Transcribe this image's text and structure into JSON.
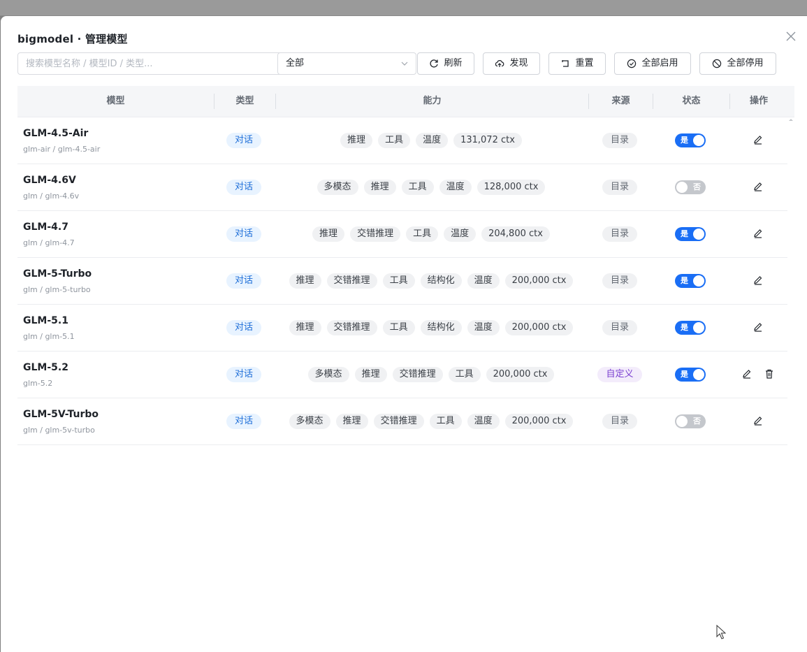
{
  "dialog": {
    "title": "bigmodel · 管理模型"
  },
  "toolbar": {
    "search_placeholder": "搜索模型名称 / 模型ID / 类型...",
    "filter_value": "全部",
    "refresh": "刷新",
    "discover": "发现",
    "reset": "重置",
    "enable_all": "全部启用",
    "disable_all": "全部停用"
  },
  "columns": {
    "model": "模型",
    "type": "类型",
    "capabilities": "能力",
    "source": "来源",
    "status": "状态",
    "actions": "操作"
  },
  "rows": [
    {
      "name": "GLM-4.5-Air",
      "id": "glm-air / glm-4.5-air",
      "type": "对话",
      "caps": [
        "推理",
        "工具",
        "温度",
        "131,072 ctx"
      ],
      "source": "目录",
      "enabled": true,
      "status": "是"
    },
    {
      "name": "GLM-4.6V",
      "id": "glm / glm-4.6v",
      "type": "对话",
      "caps": [
        "多模态",
        "推理",
        "工具",
        "温度",
        "128,000 ctx"
      ],
      "source": "目录",
      "enabled": false,
      "status": "否"
    },
    {
      "name": "GLM-4.7",
      "id": "glm / glm-4.7",
      "type": "对话",
      "caps": [
        "推理",
        "交错推理",
        "工具",
        "温度",
        "204,800 ctx"
      ],
      "source": "目录",
      "enabled": true,
      "status": "是"
    },
    {
      "name": "GLM-5-Turbo",
      "id": "glm / glm-5-turbo",
      "type": "对话",
      "caps": [
        "推理",
        "交错推理",
        "工具",
        "结构化",
        "温度",
        "200,000 ctx"
      ],
      "source": "目录",
      "enabled": true,
      "status": "是"
    },
    {
      "name": "GLM-5.1",
      "id": "glm / glm-5.1",
      "type": "对话",
      "caps": [
        "推理",
        "交错推理",
        "工具",
        "结构化",
        "温度",
        "200,000 ctx"
      ],
      "source": "目录",
      "enabled": true,
      "status": "是"
    },
    {
      "name": "GLM-5.2",
      "id": "glm-5.2",
      "type": "对话",
      "caps": [
        "多模态",
        "推理",
        "交错推理",
        "工具",
        "200,000 ctx"
      ],
      "source": "自定义",
      "enabled": true,
      "status": "是"
    },
    {
      "name": "GLM-5V-Turbo",
      "id": "glm / glm-5v-turbo",
      "type": "对话",
      "caps": [
        "多模态",
        "推理",
        "交错推理",
        "工具",
        "温度",
        "200,000 ctx"
      ],
      "source": "目录",
      "enabled": false,
      "status": "否"
    }
  ],
  "icons": {
    "close": "close-icon",
    "refresh": "refresh-icon",
    "discover": "cloud-upload-icon",
    "reset": "reset-icon",
    "enable_all": "check-circle-icon",
    "disable_all": "ban-icon",
    "edit": "edit-icon",
    "delete": "trash-icon"
  },
  "colors": {
    "accent": "#1a6ef5",
    "type_tag_bg": "#e8f3ff",
    "custom_tag": "#7b3fd1"
  }
}
